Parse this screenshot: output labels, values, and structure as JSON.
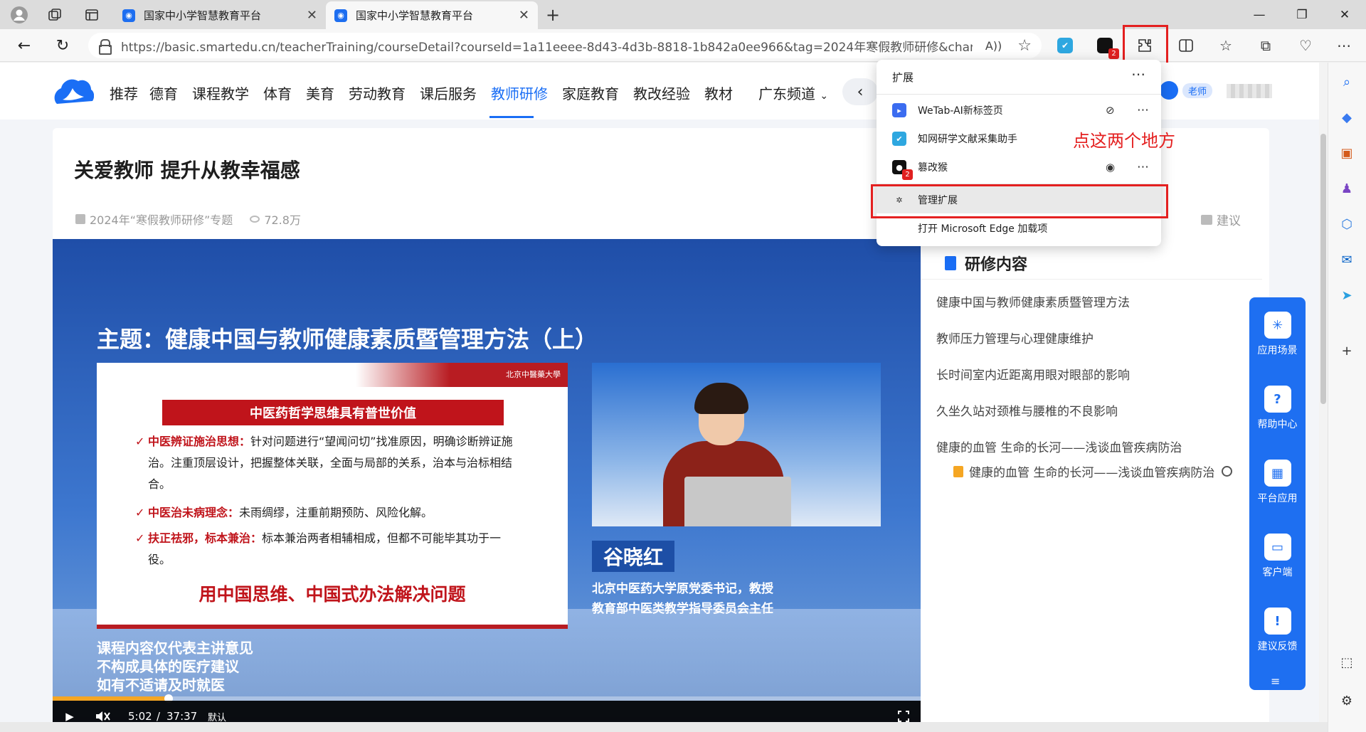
{
  "browser": {
    "tabs": [
      {
        "title": "国家中小学智慧教育平台",
        "active": false
      },
      {
        "title": "国家中小学智慧教育平台",
        "active": true
      }
    ],
    "url": "https://basic.smartedu.cn/teacherTraining/courseDetail?courseId=1a11eeee-8d43-4d3b-8818-1b842a0ee966&tag=2024年寒假教师研修&channelId=...",
    "read_aloud_label": "A))",
    "extension_badge": "2",
    "toolbar_icons": [
      "wetab-icon",
      "cnki-icon",
      "tampermonkey-icon",
      "extensions-icon",
      "split-screen-icon",
      "favorites-icon",
      "collections-icon",
      "health-icon",
      "more-icon"
    ],
    "accent": "#1a6ef5",
    "highlight": "#e42020"
  },
  "site_nav": {
    "items": [
      "推荐",
      "德育",
      "课程教学",
      "体育",
      "美育",
      "劳动教育",
      "课后服务",
      "教师研修",
      "家庭教育",
      "教改经验",
      "教材",
      "广东频道"
    ],
    "active": "教师研修",
    "role_tag": "老师"
  },
  "course": {
    "title": "关爱教师 提升从教幸福感",
    "topic_tag": "2024年“寒假教师研修”专题",
    "views": "72.8万",
    "suggest": "建议"
  },
  "video": {
    "topic": "主题：健康中国与教师健康素质暨管理方法（上）",
    "slide_university": "北京中醫藥大學",
    "slide_banner": "中医药哲学思维具有普世价值",
    "slide_items": [
      {
        "key": "中医辨证施治思想：",
        "text": "针对问题进行“望闻问切”找准原因，明确诊断辨证施治。注重顶层设计，把握整体关联，全面与局部的关系，治本与治标相结合。"
      },
      {
        "key": "中医治未病理念：",
        "text": "未雨绸缪，注重前期预防、风险化解。"
      },
      {
        "key": "扶正祛邪，标本兼治：",
        "text": "标本兼治两者相辅相成，但都不可能毕其功于一役。"
      }
    ],
    "slide_slogan": "用中国思维、中国式办法解决问题",
    "speaker_name": "谷晓红",
    "speaker_info_1": "北京中医药大学原党委书记，教授",
    "speaker_info_2": "教育部中医类教学指导委员会主任",
    "disclaimer_1": "课程内容仅代表主讲意见",
    "disclaimer_2": "不构成具体的医疗建议",
    "disclaimer_3": "如有不适请及时就医",
    "time_current": "5:02",
    "time_sep": "/",
    "time_total": "37:37",
    "quality": "默认",
    "progress_fraction": 0.134
  },
  "content_panel": {
    "heading": "研修内容",
    "lessons": [
      "健康中国与教师健康素质暨管理方法",
      "教师压力管理与心理健康维护",
      "长时间室内近距离用眼对眼部的影响",
      "久坐久站对颈椎与腰椎的不良影响",
      "健康的血管 生命的长河——浅谈血管疾病防治"
    ],
    "sublesson": "健康的血管 生命的长河——浅谈血管疾病防治"
  },
  "app_sidebar": {
    "items": [
      "应用场景",
      "帮助中心",
      "平台应用",
      "客户端",
      "建议反馈"
    ]
  },
  "extensions_popup": {
    "title": "扩展",
    "items": [
      {
        "name": "WeTab-AI新标签页",
        "color": "#3b6cf0"
      },
      {
        "name": "知网研学文献采集助手",
        "color": "#2ea7e0"
      },
      {
        "name": "篡改猴",
        "color": "#111111"
      }
    ],
    "manage": "管理扩展",
    "open_addons": "打开 Microsoft Edge 加载项"
  },
  "annotation": "点这两个地方"
}
